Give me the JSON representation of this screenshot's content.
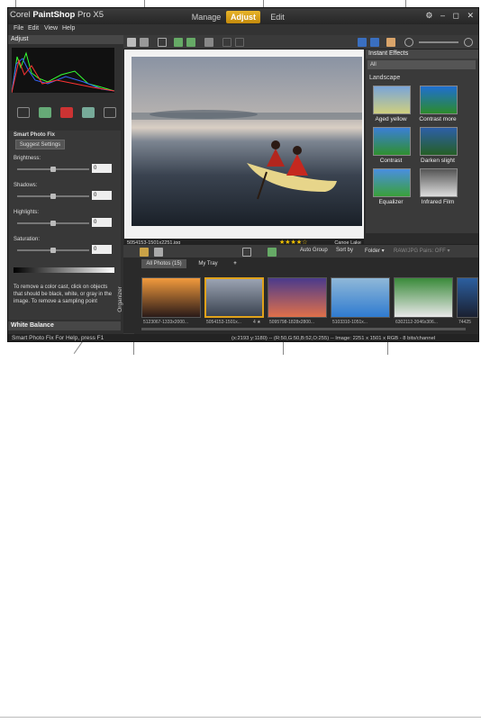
{
  "app": {
    "logo_prefix": "Corel ",
    "logo_name": "PaintShop",
    "logo_suffix": " Pro X5",
    "tabs": [
      {
        "label": "Manage"
      },
      {
        "label": "Adjust",
        "active": true
      },
      {
        "label": "Edit"
      }
    ],
    "window_buttons": "⚙ – ◻ ✕"
  },
  "menu": [
    "File",
    "Edit",
    "View",
    "Help"
  ],
  "adjust_panel": {
    "title": "Adjust",
    "smart_photo_fix": {
      "title": "Smart Photo Fix",
      "suggest_button": "Suggest Settings",
      "brightness_label": "Brightness:",
      "brightness_value": "0",
      "shadows_label": "Shadows:",
      "shadows_value": "0",
      "highlights_label": "Highlights:",
      "highlights_value": "0",
      "saturation_label": "Saturation:",
      "saturation_value": "0",
      "help_text": "To remove a color cast, click on objects that should be black, white, or gray in the image. To remove a sampling point"
    },
    "white_balance": "White Balance"
  },
  "canvas": {
    "filename": "5054153-1501x2251.jpg",
    "caption": "Canoe Lake",
    "rating": "★★★★☆"
  },
  "instant_effects": {
    "title": "Instant Effects",
    "filter_value": "All",
    "category": "Landscape",
    "effects": [
      {
        "label": "Aged yellow"
      },
      {
        "label": "Contrast more"
      },
      {
        "label": "Contrast"
      },
      {
        "label": "Darken slight"
      },
      {
        "label": "Equalizer"
      },
      {
        "label": "Infrared Film"
      }
    ]
  },
  "organizer": {
    "title": "Organizer",
    "toolbar": {
      "auto_group": "Auto Group",
      "sort_by": "Sort by",
      "folder": "Folder ▾",
      "raw": "RAW/JPG Pairs: OFF ▾"
    },
    "tabs": [
      {
        "label": "All Photos (15)"
      },
      {
        "label": "My Tray"
      },
      {
        "label": "+"
      }
    ],
    "thumbnails": [
      {
        "caption": "5123067-1333x2000..."
      },
      {
        "caption": "5054153-1501x...",
        "rating": "4 ★"
      },
      {
        "caption": "5095798-1828x2800..."
      },
      {
        "caption": "5103310-1051x..."
      },
      {
        "caption": "6302112-2046x306..."
      },
      {
        "caption": "74425"
      }
    ]
  },
  "status": {
    "left": "Smart Photo Fix For Help, press F1",
    "right": "(x:2193 y:1180) -- (R:50,G:50,B:52,O:255) -- Image:  2251 x 1501 x RGB - 8 bits/channel"
  }
}
